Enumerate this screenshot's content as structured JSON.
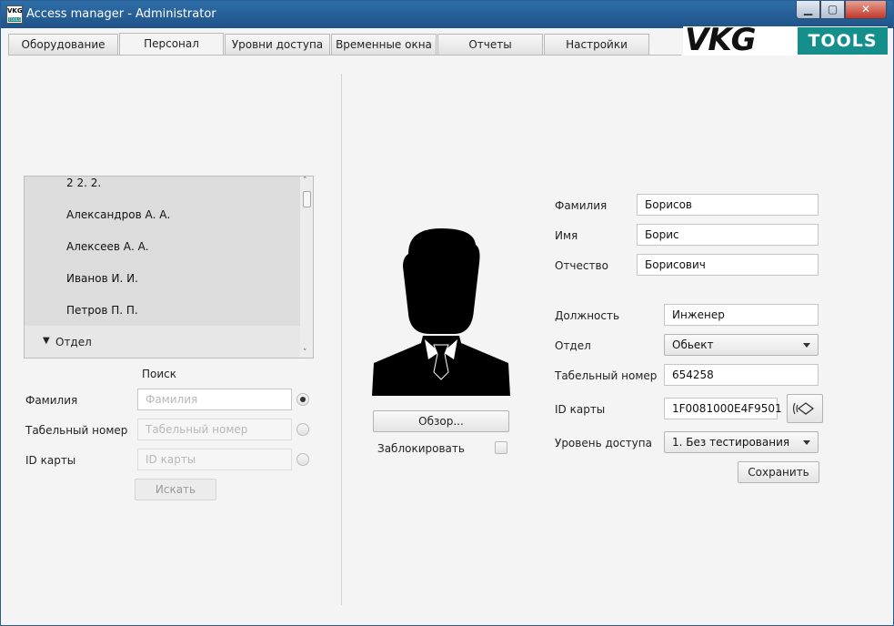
{
  "window": {
    "title": "Access manager - Administrator",
    "icon_text": "VKG",
    "icon_sub": "TOOLS",
    "controls": {
      "minimize": "▁",
      "maximize": "▢",
      "close": "✕"
    }
  },
  "logo": {
    "vkg": "VKG",
    "tools": "TOOLS"
  },
  "tabs": [
    {
      "label": "Оборудование",
      "active": false
    },
    {
      "label": "Персонал",
      "active": true
    },
    {
      "label": "Уровни доступа",
      "active": false
    },
    {
      "label": "Временные окна",
      "active": false
    },
    {
      "label": "Отчеты",
      "active": false
    },
    {
      "label": "Настройки",
      "active": false
    }
  ],
  "tree": {
    "items": [
      "2 2. 2.",
      "Александров А. А.",
      "Алексеев А. А.",
      "Иванов И. И.",
      "Петров П. П."
    ],
    "group": {
      "arrow": "▼",
      "label": "Отдел"
    },
    "scroll": {
      "up": "˄",
      "down": "˅"
    }
  },
  "search": {
    "title": "Поиск",
    "fields": [
      {
        "label": "Фамилия",
        "placeholder": "Фамилия",
        "selected": true
      },
      {
        "label": "Табельный номер",
        "placeholder": "Табельный номер",
        "selected": false
      },
      {
        "label": "ID карты",
        "placeholder": "ID карты",
        "selected": false
      }
    ],
    "button": "Искать"
  },
  "photo": {
    "browse_button": "Обзор...",
    "block_label": "Заблокировать",
    "blocked": false
  },
  "person": {
    "surname_label": "Фамилия",
    "surname": "Борисов",
    "name_label": "Имя",
    "name": "Борис",
    "patronymic_label": "Отчество",
    "patronymic": "Борисович",
    "position_label": "Должность",
    "position": "Инженер",
    "department_label": "Отдел",
    "department": "Обьект",
    "tab_number_label": "Табельный номер",
    "tab_number": "654258",
    "card_label": "ID карты",
    "card": "1F0081000E4F9501",
    "access_label": "Уровень доступа",
    "access": "1. Без тестирования",
    "save_button": "Сохранить"
  },
  "colors": {
    "titlebar": "#2f6ea8",
    "logo_teal": "#158f8c",
    "close": "#c0392b"
  }
}
